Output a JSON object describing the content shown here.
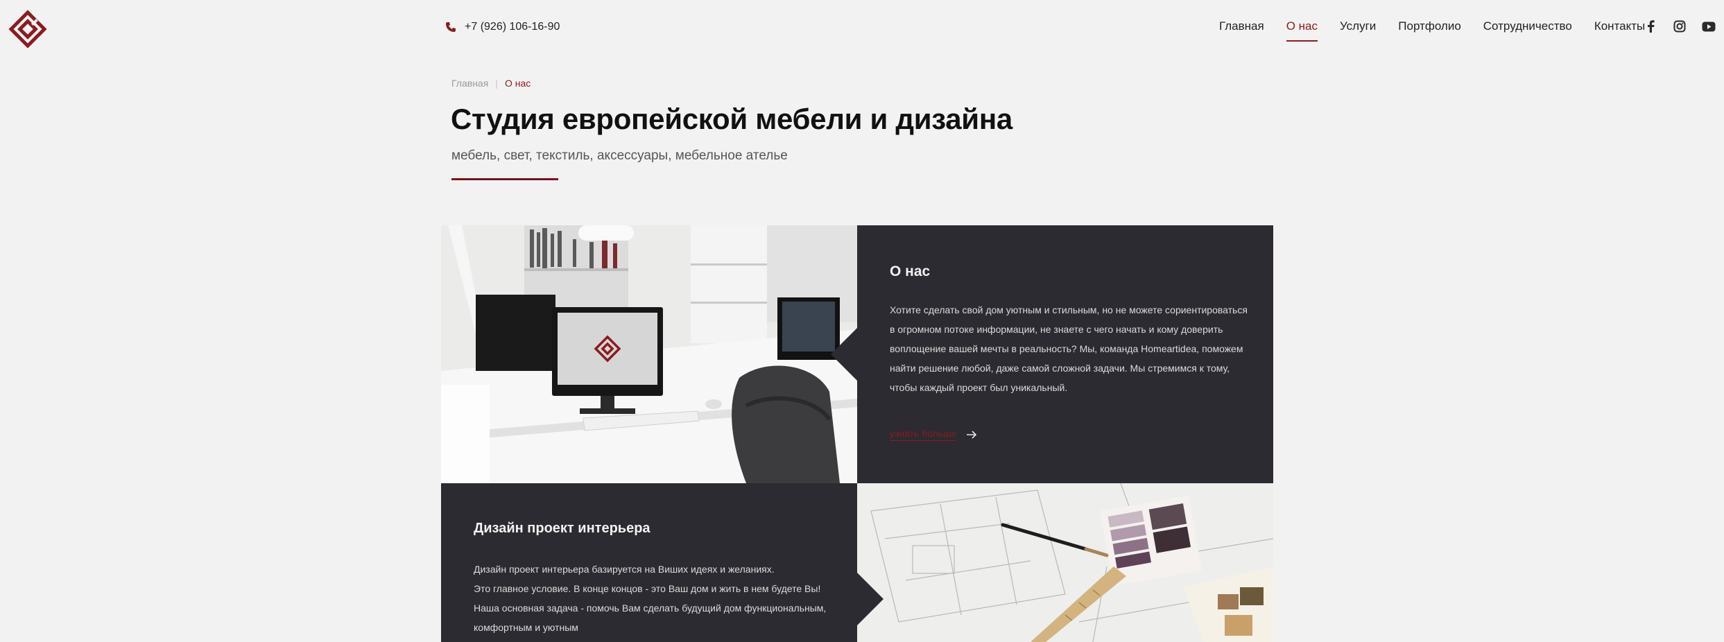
{
  "header": {
    "phone": "+7 (926) 106-16-90",
    "nav": [
      "Главная",
      "О нас",
      "Услуги",
      "Портфолио",
      "Сотрудничество",
      "Контакты"
    ],
    "active_nav": "О нас",
    "socials": [
      "facebook-icon",
      "instagram-icon",
      "youtube-icon"
    ]
  },
  "breadcrumb": {
    "home": "Главная",
    "separator": "|",
    "current": "О нас"
  },
  "intro": {
    "title": "Студия европейской мебели и дизайна",
    "subtitle": "мебель, свет, текстиль, аксессуары, мебельное ателье"
  },
  "about": {
    "title": "О нас",
    "text": "Хотите сделать свой дом уютным и стильным, но не можете сориентироваться в огромном потоке информации, не знаете с чего начать и кому доверить воплощение вашей мечты в реальность? Мы, команда Homeartidea, поможем найти решение любой, даже самой сложной задачи. Мы стремимся к тому, чтобы каждый проект был уникальный.",
    "link": "узнать больше"
  },
  "design": {
    "title": "Дизайн проект интерьера",
    "lines": [
      "Дизайн проект интерьера базируется на Виших идеях и желаниях.",
      "Это главное условие. В конце концов - это Ваш дом и жить в нем будете Вы!",
      "Наша основная задача - помочь Вам сделать будущий дом функциональным,",
      "комфортным и уютным"
    ]
  },
  "colors": {
    "accent": "#8a1c1f",
    "dark_panel": "#2b2b31",
    "background": "#f2f2f2"
  }
}
